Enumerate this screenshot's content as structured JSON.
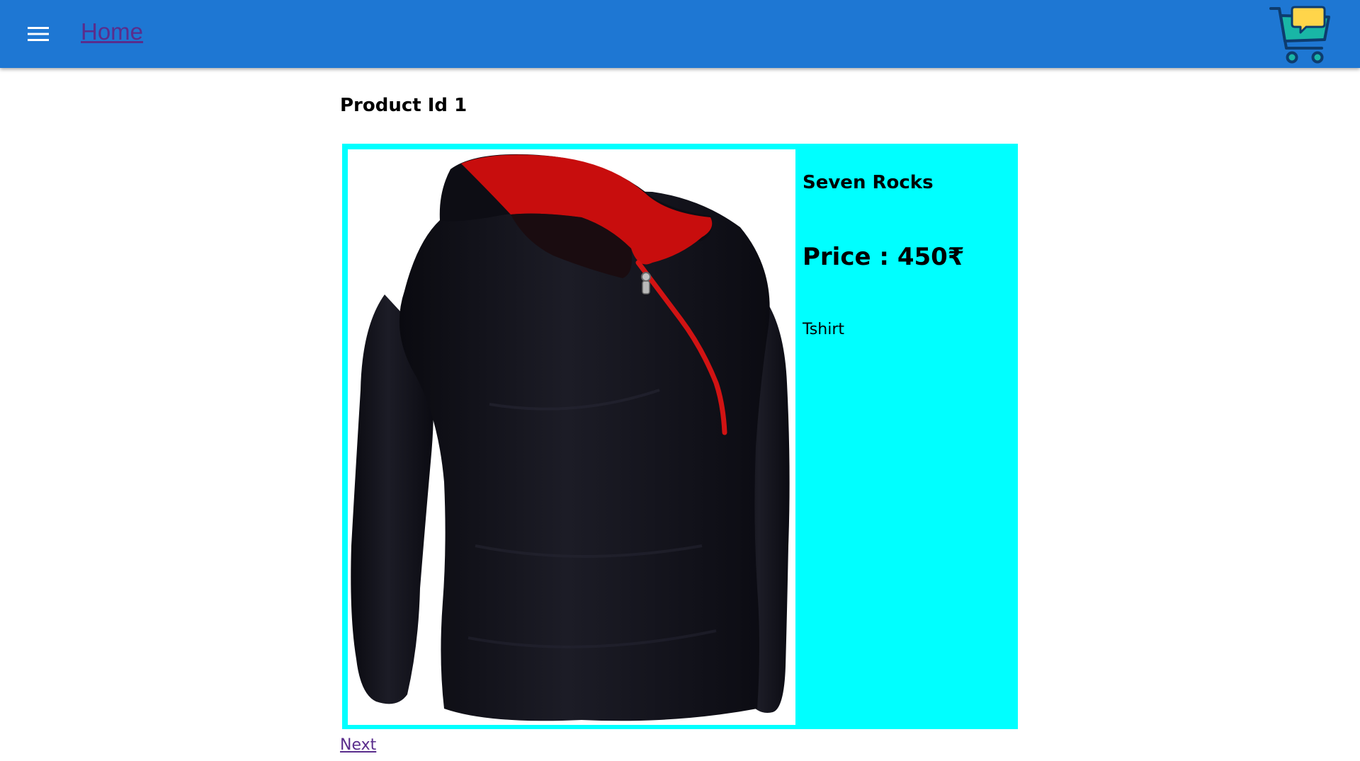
{
  "header": {
    "menu_icon": "hamburger-menu-icon",
    "home_link": "Home",
    "cart_icon": "shopping-cart-with-chat-bubble-icon",
    "bar_color": "#1e77d3"
  },
  "page": {
    "title": "Product Id 1"
  },
  "product": {
    "image": "black-hoodie-red-lining-photo",
    "brand": "Seven Rocks",
    "price": "Price : 450₹",
    "category": "Tshirt",
    "card_color": "#00ffff"
  },
  "footer": {
    "next_link": "Next"
  }
}
